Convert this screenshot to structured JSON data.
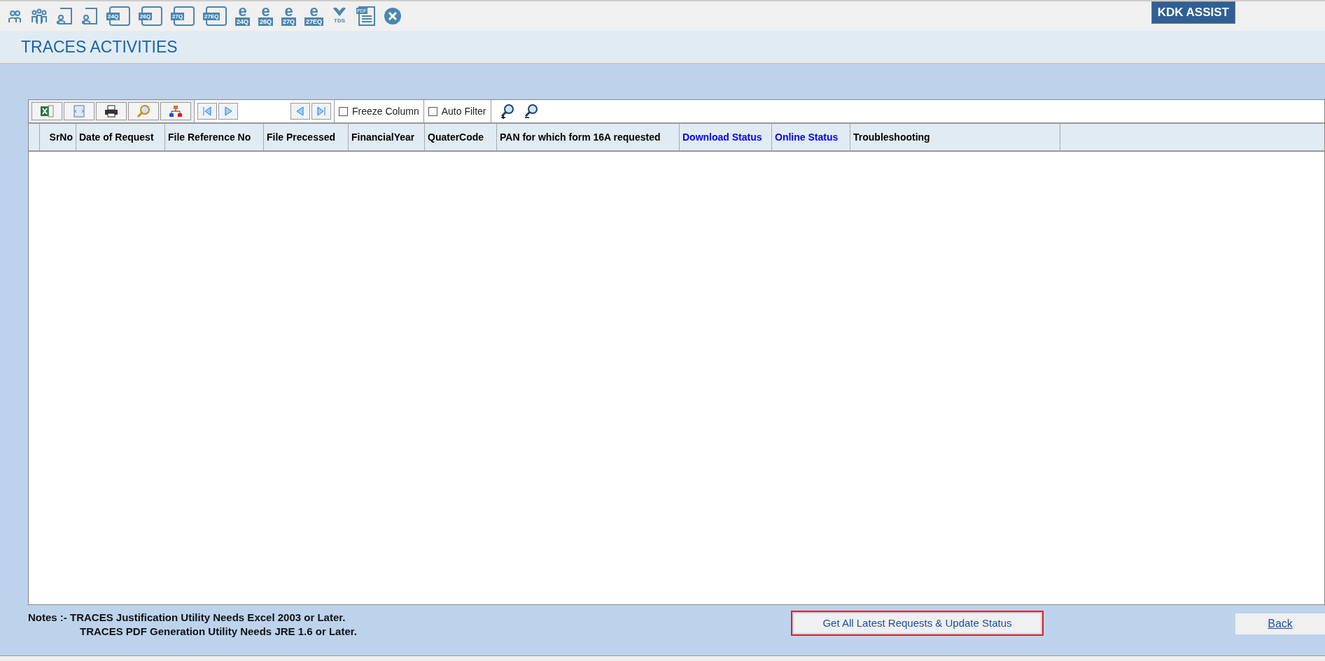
{
  "top_toolbar": [
    {
      "kind": "person"
    },
    {
      "kind": "group"
    },
    {
      "kind": "form"
    },
    {
      "kind": "form"
    },
    {
      "kind": "return",
      "label": "24Q"
    },
    {
      "kind": "return",
      "label": "26Q"
    },
    {
      "kind": "return",
      "label": "27Q"
    },
    {
      "kind": "return",
      "label": "27EQ"
    },
    {
      "kind": "ereturn",
      "mark": "e",
      "label": "24Q"
    },
    {
      "kind": "ereturn",
      "mark": "e",
      "label": "26Q"
    },
    {
      "kind": "ereturn",
      "mark": "e",
      "label": "27Q"
    },
    {
      "kind": "ereturn",
      "mark": "e",
      "label": "27EQ"
    },
    {
      "kind": "tds",
      "label": "TDS"
    },
    {
      "kind": "pdf",
      "label": "PDF"
    },
    {
      "kind": "close"
    }
  ],
  "brand": "KDK ASSIST",
  "title": "TRACES ACTIVITIES",
  "grid_toolbar": {
    "checkboxes": [
      {
        "label": "Freeze Column",
        "checked": false
      },
      {
        "label": "Auto Filter",
        "checked": false
      }
    ]
  },
  "table": {
    "columns": [
      {
        "label": "SrNo",
        "color": "#000000"
      },
      {
        "label": "Date of Request",
        "color": "#000000"
      },
      {
        "label": "File Reference No",
        "color": "#000000"
      },
      {
        "label": "File Precessed",
        "color": "#000000"
      },
      {
        "label": "FinancialYear",
        "color": "#000000"
      },
      {
        "label": "QuaterCode",
        "color": "#000000"
      },
      {
        "label": "PAN for which form 16A requested",
        "color": "#000000"
      },
      {
        "label": "Download Status",
        "color": "#0000ff"
      },
      {
        "label": "Online  Status",
        "color": "#0000ff"
      },
      {
        "label": "Troubleshooting",
        "color": "#000000"
      }
    ]
  },
  "notes": [
    "Notes :- TRACES Justification Utility Needs Excel 2003 or Later.",
    "TRACES PDF Generation Utility Needs JRE 1.6 or Later."
  ],
  "update_button": "Get All Latest Requests & Update Status",
  "back_button": "Back"
}
